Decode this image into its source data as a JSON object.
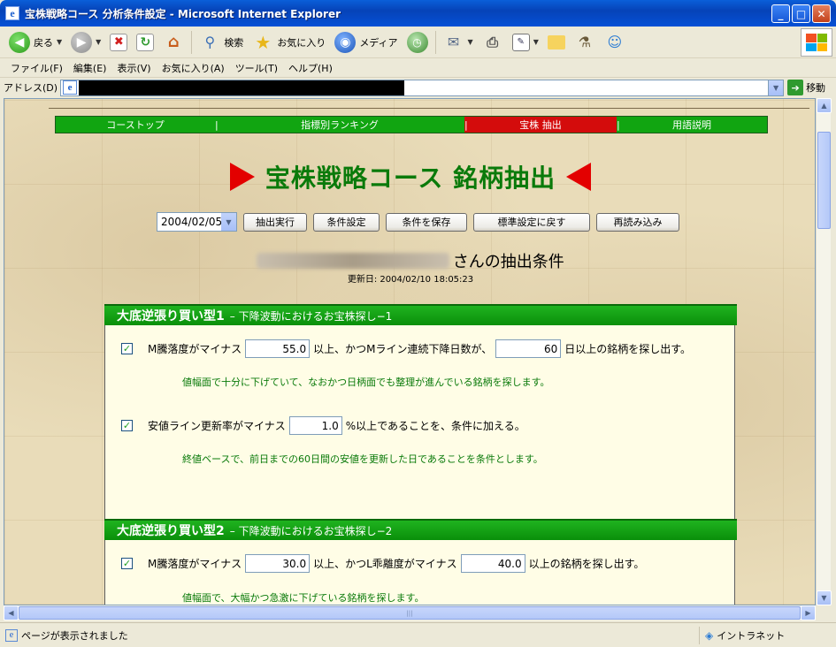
{
  "window": {
    "title": "宝株戦略コース 分析条件設定 - Microsoft Internet Explorer"
  },
  "toolbar": {
    "back_label": "戻る",
    "search_label": "検索",
    "favorites_label": "お気に入り",
    "media_label": "メディア"
  },
  "menu": {
    "items": [
      "ファイル(F)",
      "編集(E)",
      "表示(V)",
      "お気に入り(A)",
      "ツール(T)",
      "ヘルプ(H)"
    ]
  },
  "address": {
    "label": "アドレス(D)",
    "go_label": "移動"
  },
  "nav": {
    "items": [
      {
        "label": "コーストップ"
      },
      {
        "label": "指標別ランキング"
      },
      {
        "label": "宝株 抽出",
        "active": true
      },
      {
        "label": "用語説明"
      }
    ]
  },
  "heading": "宝株戦略コース 銘柄抽出",
  "controls": {
    "date_value": "2004/02/05",
    "buttons": [
      "抽出実行",
      "条件設定",
      "条件を保存",
      "標準設定に戻す",
      "再読み込み"
    ]
  },
  "user": {
    "suffix": "さんの抽出条件",
    "updated": "更新日: 2004/02/10 18:05:23"
  },
  "sections": [
    {
      "title": "大底逆張り買い型1",
      "subtitle": "– 下降波動におけるお宝株探し−1",
      "rows": [
        {
          "checked": true,
          "text1": "M騰落度がマイナス",
          "value1": "55.0",
          "text2": "以上、かつMライン連続下降日数が、",
          "value2": "60",
          "text3": "日以上の銘柄を探し出す。",
          "note": "値幅面で十分に下げていて、なおかつ日柄面でも整理が進んでいる銘柄を探します。"
        },
        {
          "checked": true,
          "text1": "安値ライン更新率がマイナス",
          "value1": "1.0",
          "text2": "%以上であることを、条件に加える。",
          "note": "終値ベースで、前日までの60日間の安値を更新した日であることを条件とします。"
        }
      ]
    },
    {
      "title": "大底逆張り買い型2",
      "subtitle": "– 下降波動におけるお宝株探し−2",
      "rows": [
        {
          "checked": true,
          "text1": "M騰落度がマイナス",
          "value1": "30.0",
          "text2": "以上、かつL乖離度がマイナス",
          "value2": "40.0",
          "text3": "以上の銘柄を探し出す。",
          "note": "値幅面で、大幅かつ急激に下げている銘柄を探します。"
        }
      ]
    }
  ],
  "status": {
    "text": "ページが表示されました",
    "zone": "イントラネット"
  }
}
